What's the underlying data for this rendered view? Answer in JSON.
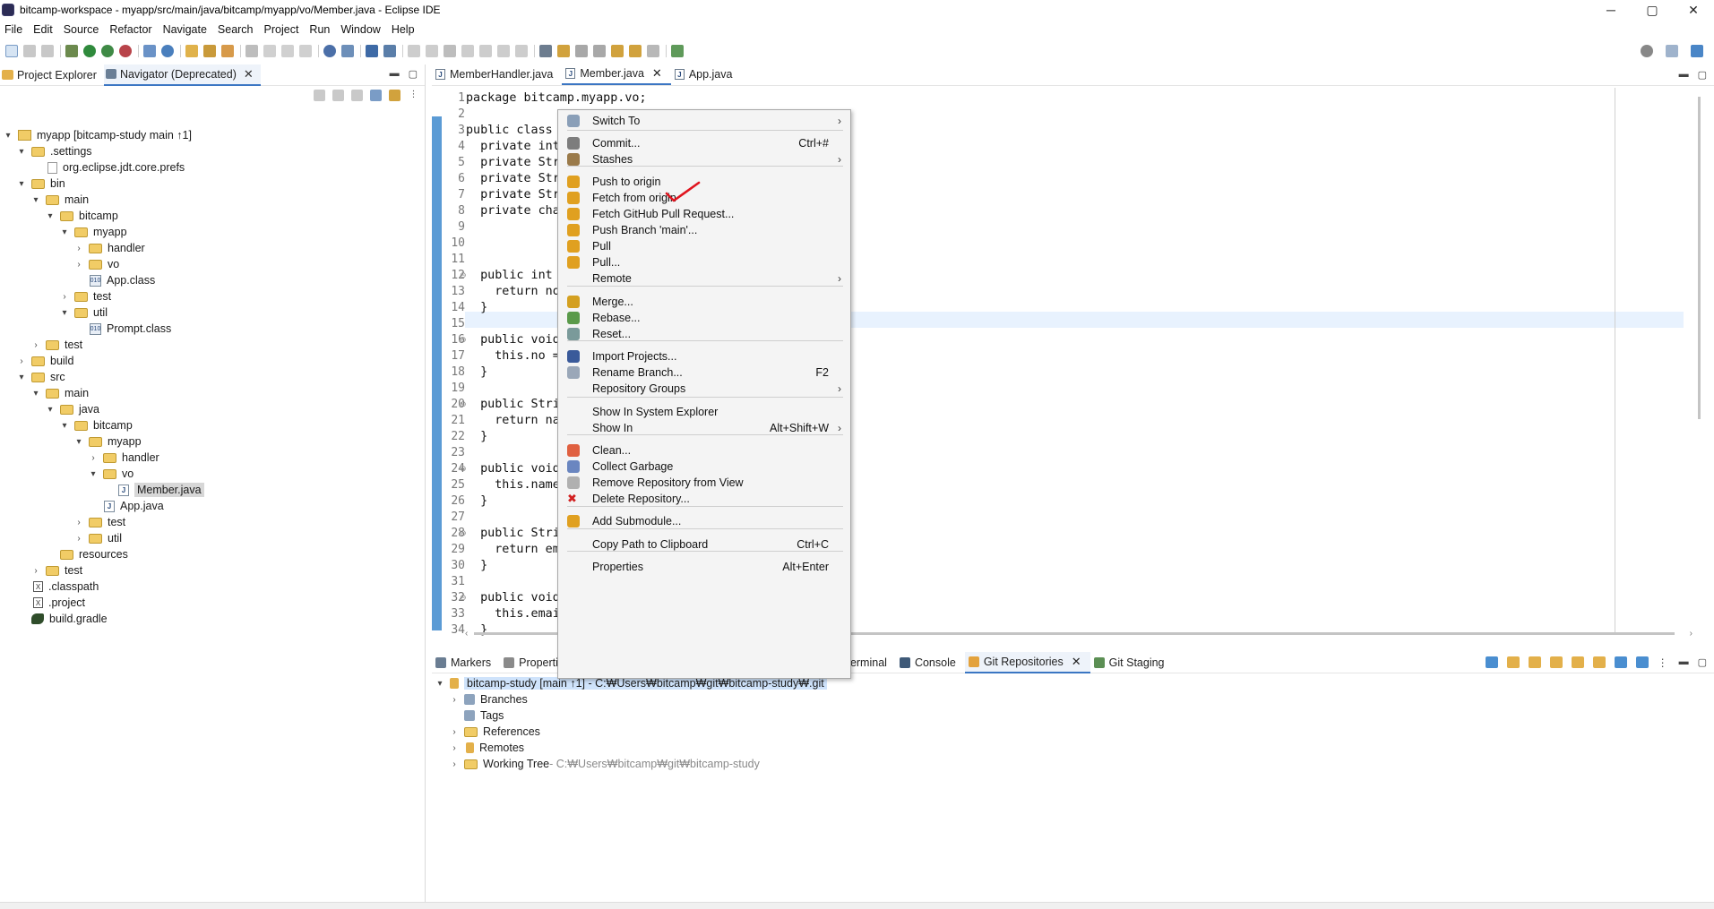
{
  "window": {
    "title": "bitcamp-workspace - myapp/src/main/java/bitcamp/myapp/vo/Member.java - Eclipse IDE",
    "minimize": "─",
    "maximize": "▢",
    "close": "✕"
  },
  "menubar": [
    "File",
    "Edit",
    "Source",
    "Refactor",
    "Navigate",
    "Search",
    "Project",
    "Run",
    "Window",
    "Help"
  ],
  "left_panel": {
    "tabs": [
      {
        "label": "Project Explorer"
      },
      {
        "label": "Navigator (Deprecated)",
        "close": "✕"
      }
    ],
    "tree": [
      {
        "label": "myapp [bitcamp-study main ↑1]"
      },
      {
        "label": ".settings"
      },
      {
        "label": "org.eclipse.jdt.core.prefs"
      },
      {
        "label": "bin"
      },
      {
        "label": "main"
      },
      {
        "label": "bitcamp"
      },
      {
        "label": "myapp"
      },
      {
        "label": "handler"
      },
      {
        "label": "vo"
      },
      {
        "label": "App.class"
      },
      {
        "label": "test"
      },
      {
        "label": "util"
      },
      {
        "label": "Prompt.class"
      },
      {
        "label": "test"
      },
      {
        "label": "build"
      },
      {
        "label": "src"
      },
      {
        "label": "main"
      },
      {
        "label": "java"
      },
      {
        "label": "bitcamp"
      },
      {
        "label": "myapp"
      },
      {
        "label": "handler"
      },
      {
        "label": "vo"
      },
      {
        "label": "Member.java"
      },
      {
        "label": "App.java"
      },
      {
        "label": "test"
      },
      {
        "label": "util"
      },
      {
        "label": "resources"
      },
      {
        "label": "test"
      },
      {
        "label": ".classpath"
      },
      {
        "label": ".project"
      },
      {
        "label": "build.gradle"
      }
    ]
  },
  "editor": {
    "tabs": [
      {
        "label": "MemberHandler.java"
      },
      {
        "label": "Member.java",
        "close": "✕"
      },
      {
        "label": "App.java"
      }
    ],
    "lines": [
      {
        "n": "1",
        "text": "package bitcamp.myapp.vo;"
      },
      {
        "n": "2",
        "text": ""
      },
      {
        "n": "3",
        "text": "public class"
      },
      {
        "n": "4",
        "text": "  private int"
      },
      {
        "n": "5",
        "text": "  private Str"
      },
      {
        "n": "6",
        "text": "  private Str"
      },
      {
        "n": "7",
        "text": "  private Str"
      },
      {
        "n": "8",
        "text": "  private cha"
      },
      {
        "n": "9",
        "text": ""
      },
      {
        "n": "10",
        "text": ""
      },
      {
        "n": "11",
        "text": ""
      },
      {
        "n": "12",
        "text": "  public int"
      },
      {
        "n": "13",
        "text": "    return no"
      },
      {
        "n": "14",
        "text": "  }"
      },
      {
        "n": "15",
        "text": ""
      },
      {
        "n": "16",
        "text": "  public void"
      },
      {
        "n": "17",
        "text": "    this.no ="
      },
      {
        "n": "18",
        "text": "  }"
      },
      {
        "n": "19",
        "text": ""
      },
      {
        "n": "20",
        "text": "  public Stri"
      },
      {
        "n": "21",
        "text": "    return na"
      },
      {
        "n": "22",
        "text": "  }"
      },
      {
        "n": "23",
        "text": ""
      },
      {
        "n": "24",
        "text": "  public void"
      },
      {
        "n": "25",
        "text": "    this.name"
      },
      {
        "n": "26",
        "text": "  }"
      },
      {
        "n": "27",
        "text": ""
      },
      {
        "n": "28",
        "text": "  public Stri"
      },
      {
        "n": "29",
        "text": "    return em"
      },
      {
        "n": "30",
        "text": "  }"
      },
      {
        "n": "31",
        "text": ""
      },
      {
        "n": "32",
        "text": "  public void"
      },
      {
        "n": "33",
        "text": "    this.emai"
      },
      {
        "n": "34",
        "text": "  }"
      }
    ]
  },
  "bottom_panel": {
    "tabs": [
      {
        "label": "Markers"
      },
      {
        "label": "Properti"
      },
      {
        "label": "erminal"
      },
      {
        "label": "Console"
      },
      {
        "label": "Git Repositories",
        "close": "✕"
      },
      {
        "label": "Git Staging"
      }
    ],
    "repo": {
      "label": "bitcamp-study [main ↑1] - C:₩Users₩bitcamp₩git₩bitcamp-study₩.git",
      "children": [
        {
          "label": "Branches"
        },
        {
          "label": "Tags"
        },
        {
          "label": "References"
        },
        {
          "label": "Remotes"
        },
        {
          "label": "Working Tree",
          "detail": " - C:₩Users₩bitcamp₩git₩bitcamp-study"
        }
      ]
    }
  },
  "context_menu": {
    "items": [
      {
        "label": "Switch To",
        "shortcut": "",
        "submenu": "›"
      },
      {
        "label": "Commit...",
        "shortcut": "Ctrl+#",
        "submenu": ""
      },
      {
        "label": "Stashes",
        "shortcut": "",
        "submenu": "›"
      },
      {
        "label": "Push to origin",
        "shortcut": "",
        "submenu": ""
      },
      {
        "label": "Fetch from origin",
        "shortcut": "",
        "submenu": ""
      },
      {
        "label": "Fetch GitHub Pull Request...",
        "shortcut": "",
        "submenu": ""
      },
      {
        "label": "Push Branch 'main'...",
        "shortcut": "",
        "submenu": ""
      },
      {
        "label": "Pull",
        "shortcut": "",
        "submenu": ""
      },
      {
        "label": "Pull...",
        "shortcut": "",
        "submenu": ""
      },
      {
        "label": "Remote",
        "shortcut": "",
        "submenu": "›"
      },
      {
        "label": "Merge...",
        "shortcut": "",
        "submenu": ""
      },
      {
        "label": "Rebase...",
        "shortcut": "",
        "submenu": ""
      },
      {
        "label": "Reset...",
        "shortcut": "",
        "submenu": ""
      },
      {
        "label": "Import Projects...",
        "shortcut": "",
        "submenu": ""
      },
      {
        "label": "Rename Branch...",
        "shortcut": "F2",
        "submenu": ""
      },
      {
        "label": "Repository Groups",
        "shortcut": "",
        "submenu": "›"
      },
      {
        "label": "Show In System Explorer",
        "shortcut": "",
        "submenu": ""
      },
      {
        "label": "Show In",
        "shortcut": "Alt+Shift+W",
        "submenu": "›"
      },
      {
        "label": "Clean...",
        "shortcut": "",
        "submenu": ""
      },
      {
        "label": "Collect Garbage",
        "shortcut": "",
        "submenu": ""
      },
      {
        "label": "Remove Repository from View",
        "shortcut": "",
        "submenu": ""
      },
      {
        "label": "Delete Repository...",
        "shortcut": "",
        "submenu": ""
      },
      {
        "label": "Add Submodule...",
        "shortcut": "",
        "submenu": ""
      },
      {
        "label": "Copy Path to Clipboard",
        "shortcut": "Ctrl+C",
        "submenu": ""
      },
      {
        "label": "Properties",
        "shortcut": "Alt+Enter",
        "submenu": ""
      }
    ]
  },
  "colors": {
    "accent": "#3b76c3",
    "selection": "#cfe3fb",
    "check_mark": "#e0141e"
  }
}
